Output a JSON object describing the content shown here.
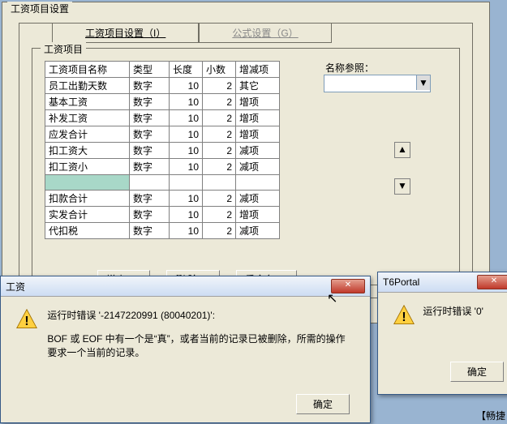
{
  "main": {
    "title": "工资项目设置"
  },
  "tabs": {
    "t1": "工资项目设置（I）",
    "t2": "公式设置（G）"
  },
  "group": {
    "label": "工资项目"
  },
  "table": {
    "headers": {
      "c0": "工资项目名称",
      "c1": "类型",
      "c2": "长度",
      "c3": "小数",
      "c4": "增减项"
    },
    "rows": [
      {
        "c0": "员工出勤天数",
        "c1": "数字",
        "c2": "10",
        "c3": "2",
        "c4": "其它"
      },
      {
        "c0": "基本工资",
        "c1": "数字",
        "c2": "10",
        "c3": "2",
        "c4": "增项"
      },
      {
        "c0": "补发工资",
        "c1": "数字",
        "c2": "10",
        "c3": "2",
        "c4": "增项"
      },
      {
        "c0": "应发合计",
        "c1": "数字",
        "c2": "10",
        "c3": "2",
        "c4": "增项"
      },
      {
        "c0": "扣工资大",
        "c1": "数字",
        "c2": "10",
        "c3": "2",
        "c4": "减项"
      },
      {
        "c0": "扣工资小",
        "c1": "数字",
        "c2": "10",
        "c3": "2",
        "c4": "减项"
      },
      {
        "c0": "",
        "c1": "",
        "c2": "",
        "c3": "",
        "c4": ""
      },
      {
        "c0": "扣款合计",
        "c1": "数字",
        "c2": "10",
        "c3": "2",
        "c4": "减项"
      },
      {
        "c0": "实发合计",
        "c1": "数字",
        "c2": "10",
        "c3": "2",
        "c4": "增项"
      },
      {
        "c0": "代扣税",
        "c1": "数字",
        "c2": "10",
        "c3": "2",
        "c4": "减项"
      }
    ]
  },
  "ref": {
    "label": "名称参照："
  },
  "spin": {
    "up": "▲",
    "down": "▼"
  },
  "buttons": {
    "add": "增  加(A)",
    "del": "删  除(D)",
    "rename": "重命名(R)"
  },
  "dialog1": {
    "title": "工资",
    "line1": "运行时错误 '-2147220991 (80040201)':",
    "line2": "BOF 或 EOF 中有一个是“真”，或者当前的记录已被删除，所需的操作要求一个当前的记录。",
    "ok": "确定"
  },
  "dialog2": {
    "title": "T6Portal",
    "msg": "运行时错误 '0'",
    "ok": "确定"
  },
  "footer": "【畅捷"
}
